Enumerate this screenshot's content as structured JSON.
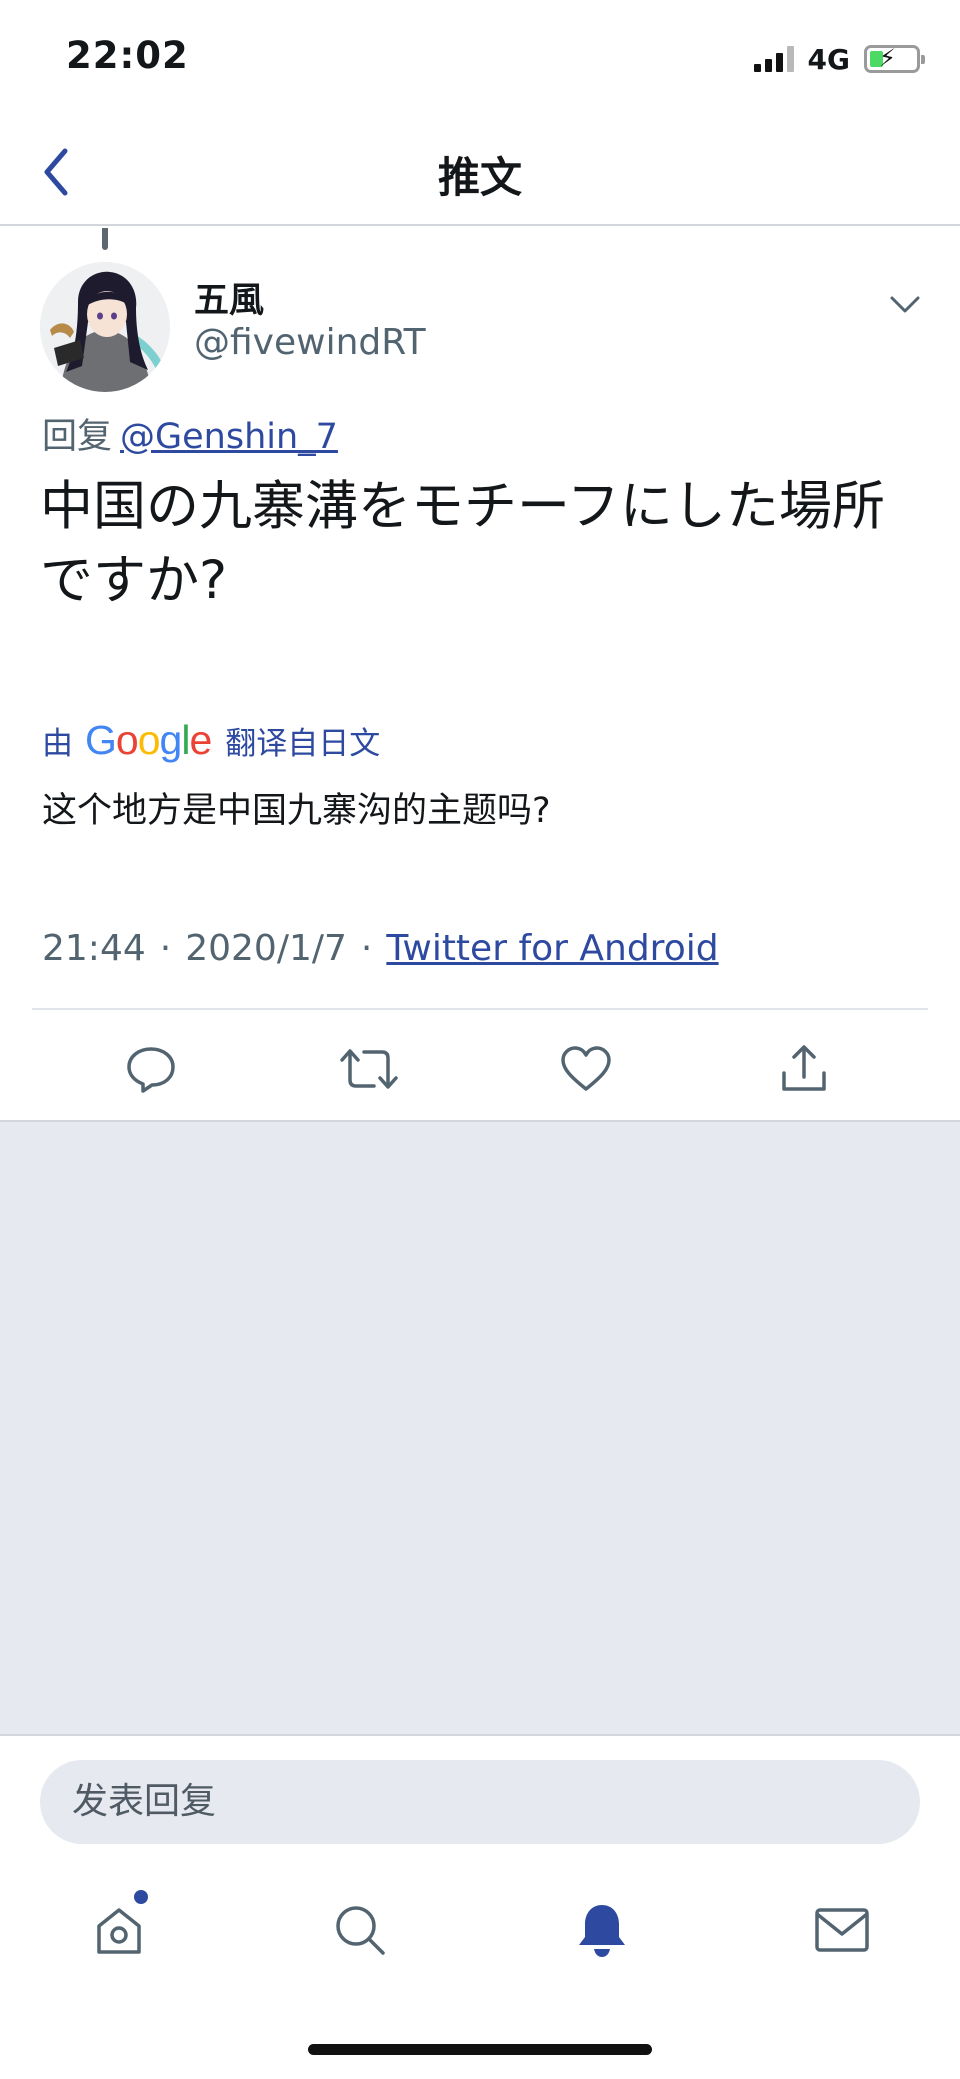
{
  "status_bar": {
    "time": "22:02",
    "network": "4G",
    "signal_bars_filled": 3,
    "signal_bars_total": 4,
    "battery_level": 0.3,
    "battery_charging": true
  },
  "header": {
    "title": "推文",
    "back_icon": "chevron-left-icon"
  },
  "tweet": {
    "display_name": "五風",
    "handle": "@fivewindRT",
    "reply_prefix": "回复",
    "reply_to": "@Genshin_7",
    "text": "中国の九寨溝をモチーフにした場所ですか?",
    "translate": {
      "prefix": "由",
      "provider": "Google",
      "suffix": "翻译自日文"
    },
    "translated_text": "这个地方是中国九寨沟的主题吗?",
    "time": "21:44",
    "date": "2020/1/7",
    "source": "Twitter for Android",
    "separator": "·"
  },
  "actions": [
    {
      "icon": "reply-icon"
    },
    {
      "icon": "retweet-icon"
    },
    {
      "icon": "like-icon"
    },
    {
      "icon": "share-icon"
    }
  ],
  "reply_box": {
    "placeholder": "发表回复"
  },
  "tab_bar": [
    {
      "icon": "home-icon",
      "has_dot": true
    },
    {
      "icon": "search-icon"
    },
    {
      "icon": "notifications-icon",
      "active": true
    },
    {
      "icon": "messages-icon"
    }
  ],
  "colors": {
    "accent": "#2e4aa0",
    "secondary_text": "#536471",
    "background_gray": "#e6e9ef"
  }
}
